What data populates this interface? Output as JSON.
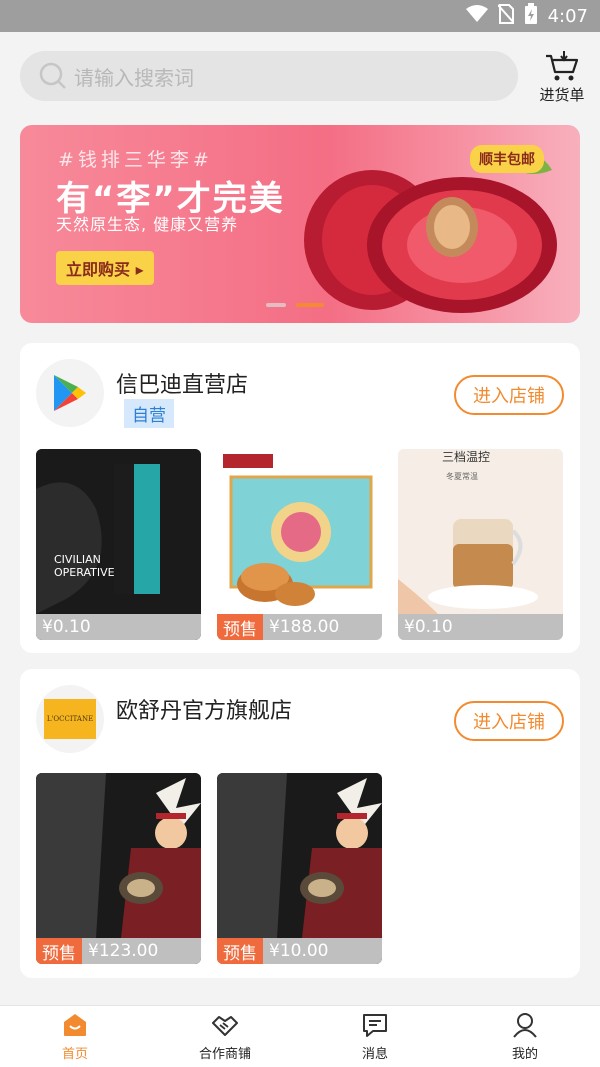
{
  "status": {
    "time": "4:07"
  },
  "header": {
    "search_placeholder": "请输入搜索词",
    "restock_label": "进货单"
  },
  "banner": {
    "tag": "#钱排三华李#",
    "headline": "有“李”才完美",
    "subtitle": "天然原生态, 健康又营养",
    "cta": "立即购买 ▸",
    "badge": "顺丰包邮",
    "slides": 2,
    "active_slide": 2
  },
  "stores": [
    {
      "name": "信巴迪直营店",
      "self_operated": "自营",
      "enter_label": "进入店铺",
      "products": [
        {
          "price": "¥0.10",
          "presale": ""
        },
        {
          "price": "¥188.00",
          "presale": "预售"
        },
        {
          "price": "¥0.10",
          "presale": ""
        }
      ]
    },
    {
      "name": "欧舒丹官方旗舰店",
      "logo_text": "L'OCCITANE",
      "enter_label": "进入店铺",
      "products": [
        {
          "price": "¥123.00",
          "presale": "预售"
        },
        {
          "price": "¥10.00",
          "presale": "预售"
        }
      ]
    }
  ],
  "product_images": {
    "p1_text": [
      "CIVILIAN",
      "OPERATIVE"
    ],
    "p3_text": [
      "三档温控",
      "冬夏常温"
    ]
  },
  "tabs": [
    {
      "label": "首页",
      "icon": "home-icon",
      "active": true
    },
    {
      "label": "合作商铺",
      "icon": "handshake-icon",
      "active": false
    },
    {
      "label": "消息",
      "icon": "message-icon",
      "active": false
    },
    {
      "label": "我的",
      "icon": "user-icon",
      "active": false
    }
  ],
  "colors": {
    "accent": "#f28b30",
    "presale": "#ef6b3d",
    "self_operated": "#2b7fd6"
  }
}
